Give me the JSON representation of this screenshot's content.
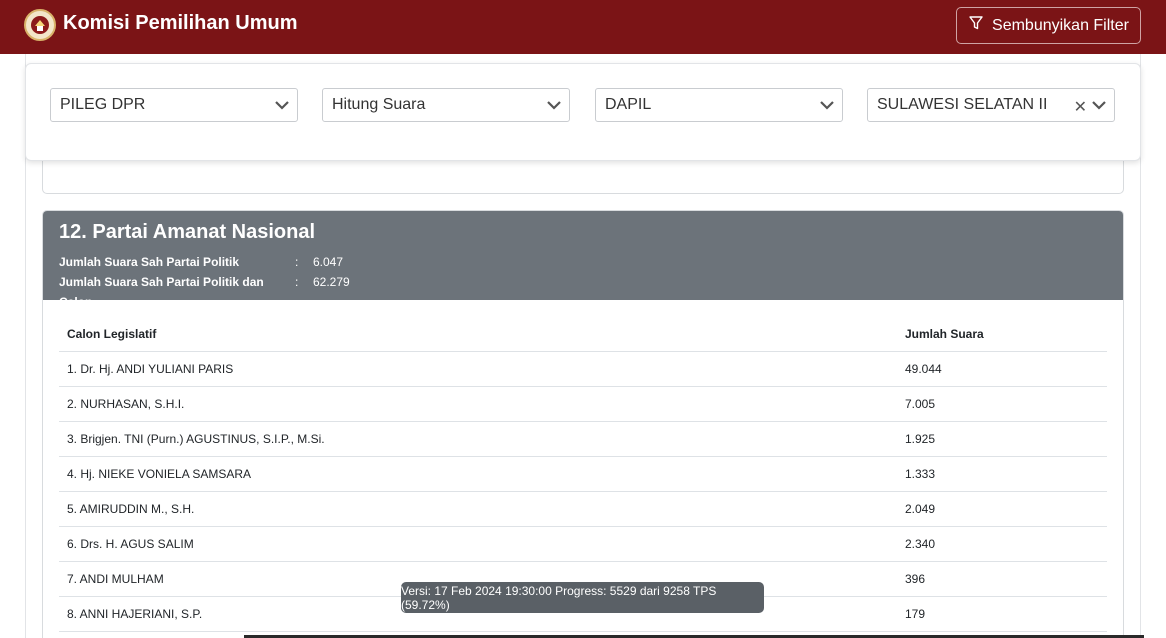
{
  "header": {
    "brand": "Komisi Pemilihan Umum",
    "filter_button_label": "Sembunyikan Filter"
  },
  "filters": [
    {
      "value": "PILEG DPR",
      "clearable": false
    },
    {
      "value": "Hitung Suara",
      "clearable": false
    },
    {
      "value": "DAPIL",
      "clearable": false
    },
    {
      "value": "SULAWESI SELATAN II",
      "clearable": true
    }
  ],
  "party": {
    "title": "12. Partai Amanat Nasional",
    "stats": [
      {
        "label": "Jumlah Suara Sah Partai Politik",
        "sep": ":",
        "value": "6.047"
      },
      {
        "label": "Jumlah Suara Sah Partai Politik dan Calon",
        "sep": ":",
        "value": "62.279"
      }
    ],
    "table": {
      "headers": [
        "Calon Legislatif",
        "Jumlah Suara"
      ],
      "rows": [
        [
          "1. Dr. Hj. ANDI YULIANI PARIS",
          "49.044"
        ],
        [
          "2. NURHASAN, S.H.I.",
          "7.005"
        ],
        [
          "3. Brigjen. TNI (Purn.) AGUSTINUS, S.I.P., M.Si.",
          "1.925"
        ],
        [
          "4. Hj. NIEKE VONIELA SAMSARA",
          "1.333"
        ],
        [
          "5. AMIRUDDIN M., S.H.",
          "2.049"
        ],
        [
          "6. Drs. H. AGUS SALIM",
          "2.340"
        ],
        [
          "7. ANDI MULHAM",
          "396"
        ],
        [
          "8. ANNI HAJERIANI, S.P.",
          "179"
        ]
      ]
    }
  },
  "version_tooltip": "Versi: 17 Feb 2024 19:30:00 Progress: 5529 dari 9258 TPS (59.72%)",
  "colors": {
    "header_bg": "#7b1416",
    "party_head_bg": "#6c737a"
  }
}
